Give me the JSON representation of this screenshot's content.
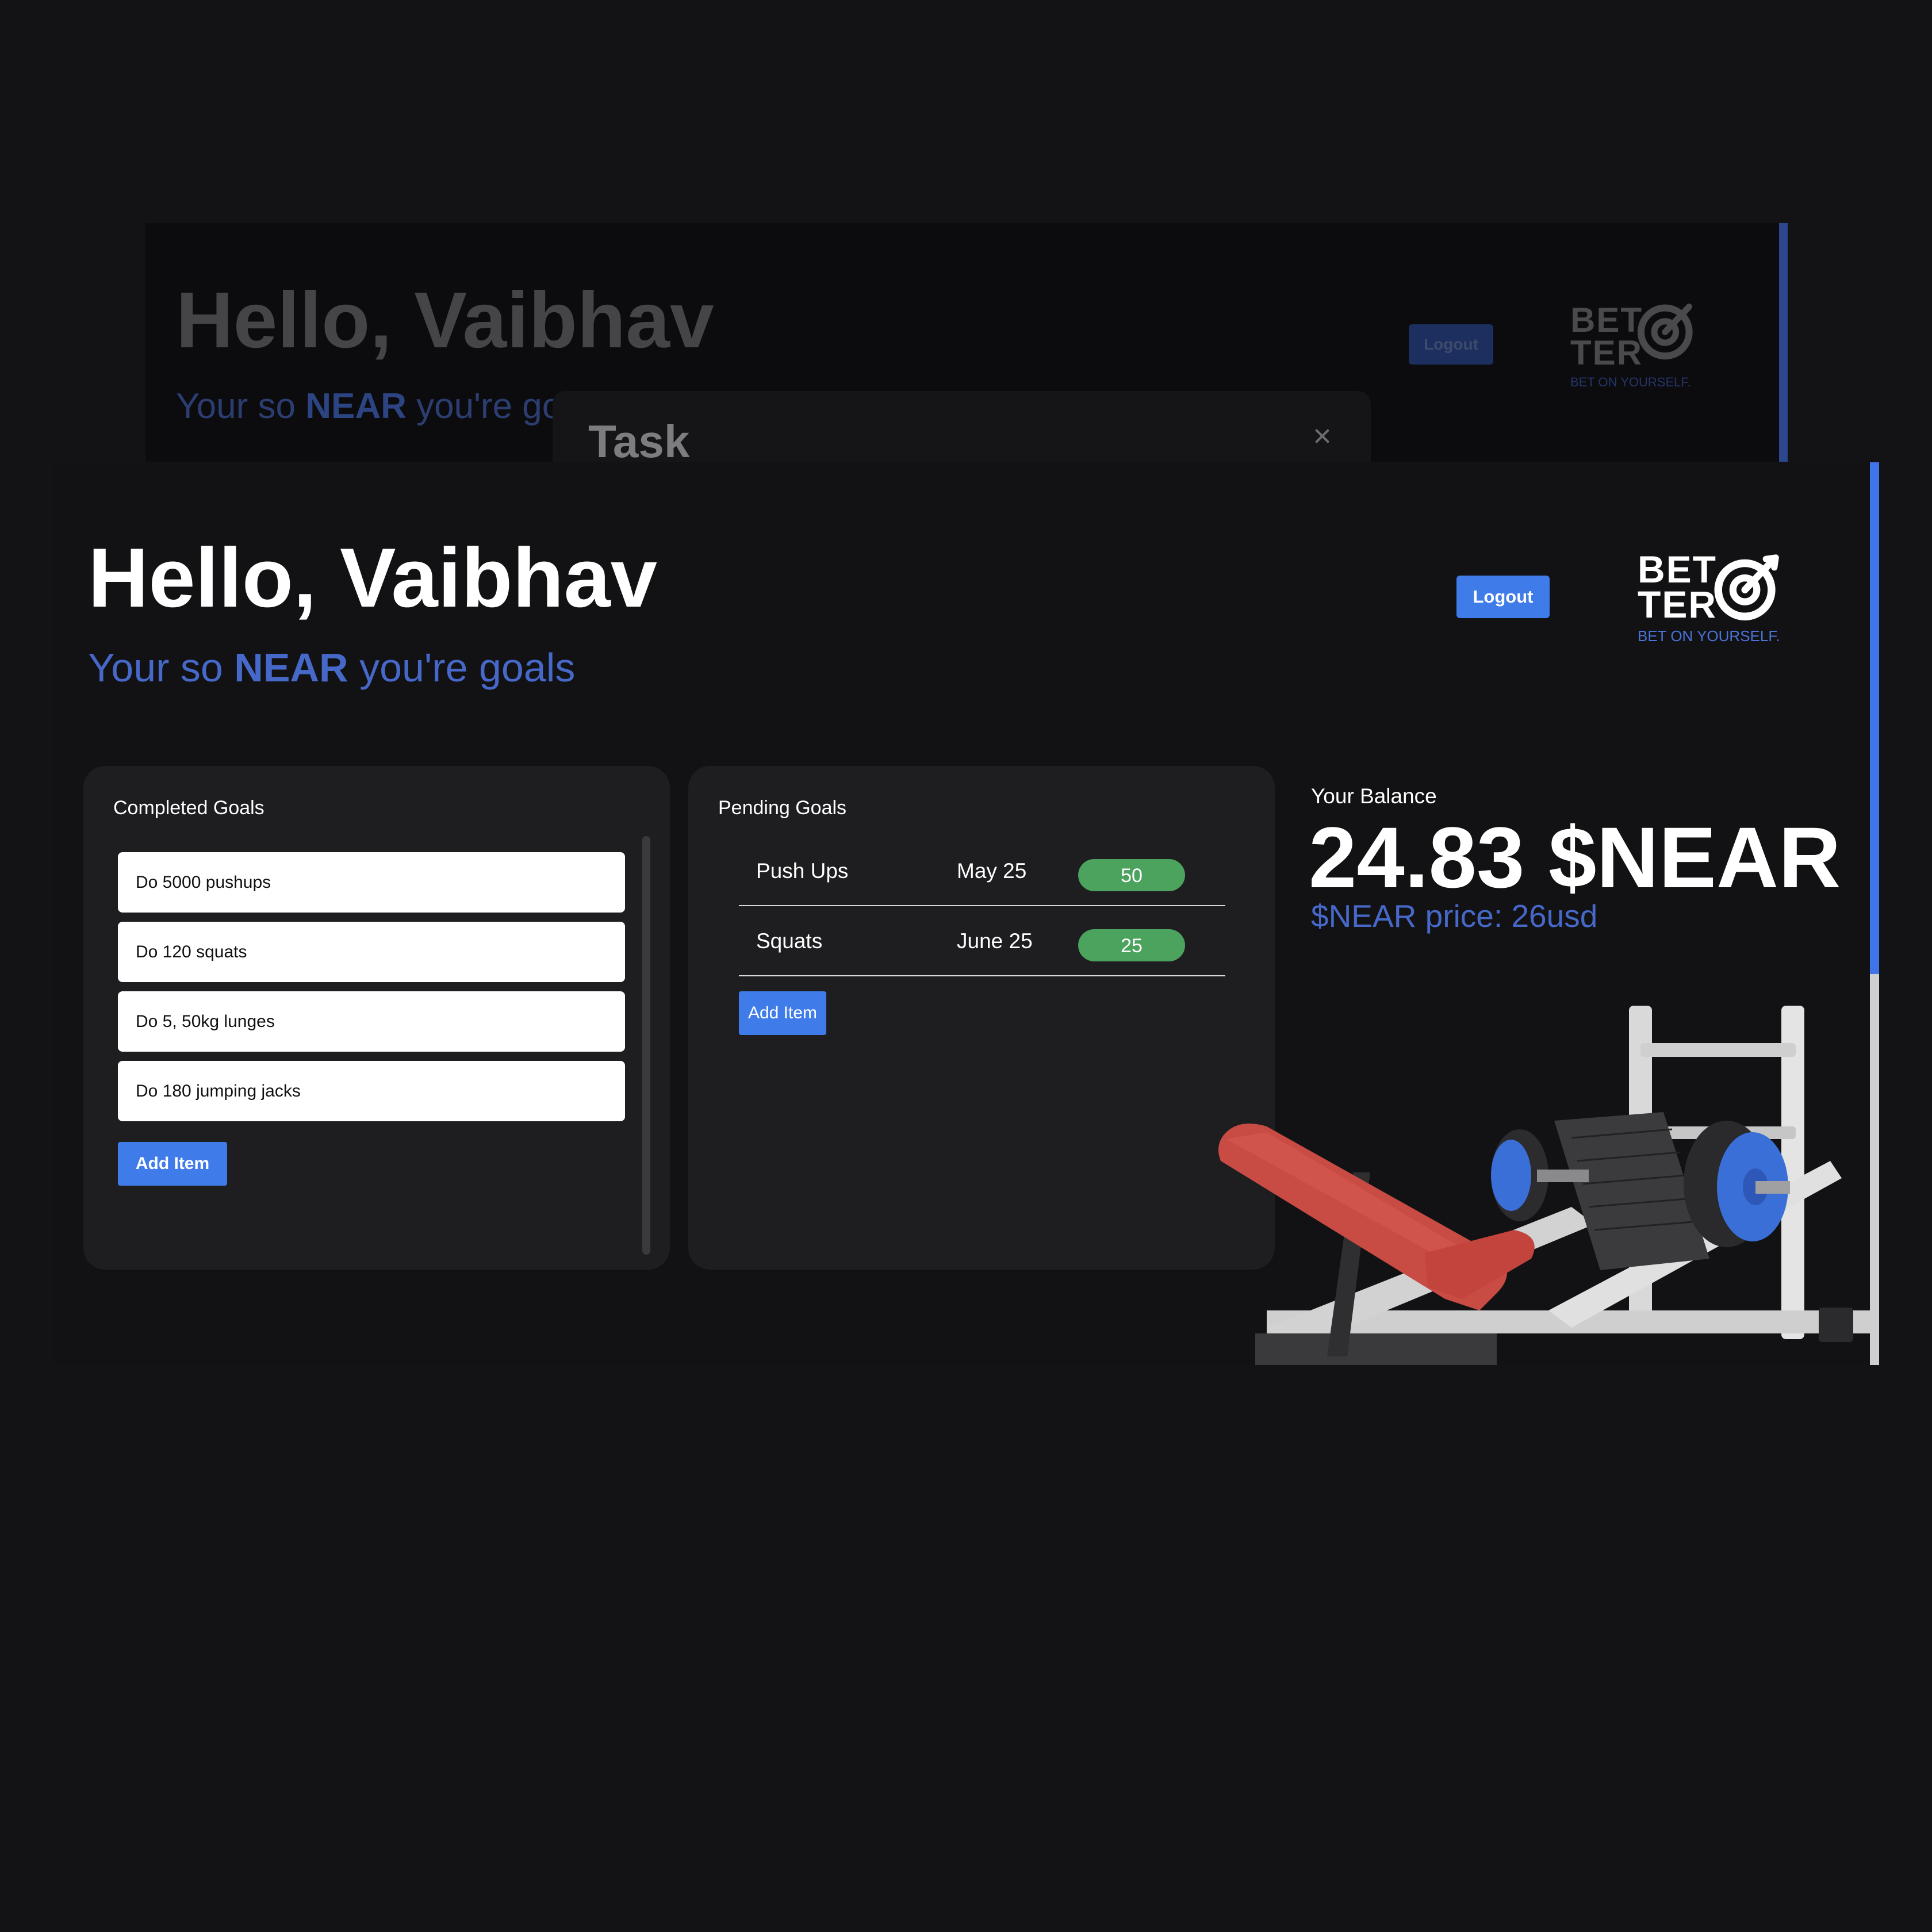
{
  "background_window": {
    "greeting": "Hello, Vaibhav",
    "subtitle_prefix": "Your so ",
    "subtitle_bold": "NEAR",
    "subtitle_suffix": " you're go",
    "logout_label": "Logout",
    "logo_line1": "BET",
    "logo_line2": "TER",
    "logo_tagline": "BET ON YOURSELF."
  },
  "modal": {
    "title": "Task",
    "close_glyph": "×"
  },
  "header": {
    "greeting": "Hello, Vaibhav",
    "subtitle_prefix": "Your so ",
    "subtitle_bold": "NEAR",
    "subtitle_suffix": " you're goals",
    "logout_label": "Logout"
  },
  "logo": {
    "line1": "BET",
    "line2": "TER",
    "tagline": "BET ON YOURSELF.",
    "icon": "target-icon"
  },
  "completed_goals": {
    "title": "Completed Goals",
    "items": [
      "Do 5000 pushups",
      "Do 120 squats",
      "Do 5, 50kg lunges",
      "Do 180 jumping jacks"
    ],
    "add_label": "Add Item"
  },
  "pending_goals": {
    "title": "Pending Goals",
    "rows": [
      {
        "name": "Push Ups",
        "date": "May 25",
        "amount": "50"
      },
      {
        "name": "Squats",
        "date": "June 25",
        "amount": "25"
      }
    ],
    "add_label": "Add Item"
  },
  "balance": {
    "label": "Your Balance",
    "amount": "24.83 $NEAR",
    "price": "$NEAR price: 26usd"
  },
  "illustration": {
    "icon": "leg-press-machine-illustration"
  },
  "colors": {
    "accent": "#3f7cea",
    "subtitle_blue": "#4668c8",
    "badge_green": "#4ba35e",
    "card_bg": "#1e1e20",
    "page_bg": "#131316"
  }
}
